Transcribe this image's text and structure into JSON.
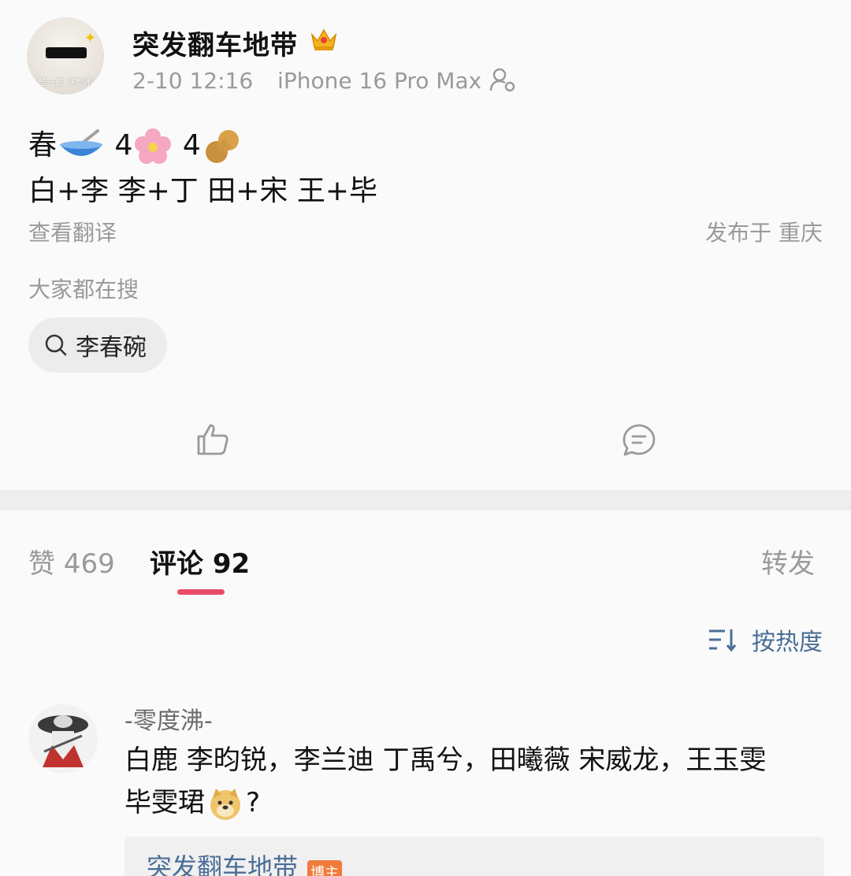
{
  "post": {
    "author": "突发翻车地带",
    "time": "2-10 12:16",
    "device": "iPhone 16 Pro Max",
    "avatar_caption": "酷一戴 谁都不",
    "content_line1_prefix": "春",
    "content_line1_num1": "4",
    "content_line1_num2": "4",
    "content_line2": "白+李 李+丁 田+宋 王+毕",
    "translate": "查看翻译",
    "location": "发布于 重庆",
    "search_title": "大家都在搜",
    "search_chip": "李春碗"
  },
  "tabs": {
    "likes": "赞 469",
    "comments": "评论 92",
    "forward": "转发"
  },
  "sort": {
    "label": "按热度"
  },
  "comment": {
    "name": "-零度沸-",
    "text_line1": "白鹿 李昀锐，李兰迪 丁禹兮，田曦薇 宋威龙，王玉雯",
    "text_line2_prefix": "毕雯珺",
    "text_line2_suffix": "?",
    "reply_name": "突发翻车地带",
    "reply_badge": "博主"
  },
  "colors": {
    "accent_underline": "#e84b6a",
    "link_blue": "#4a6e96",
    "muted": "#9a9a9a"
  }
}
